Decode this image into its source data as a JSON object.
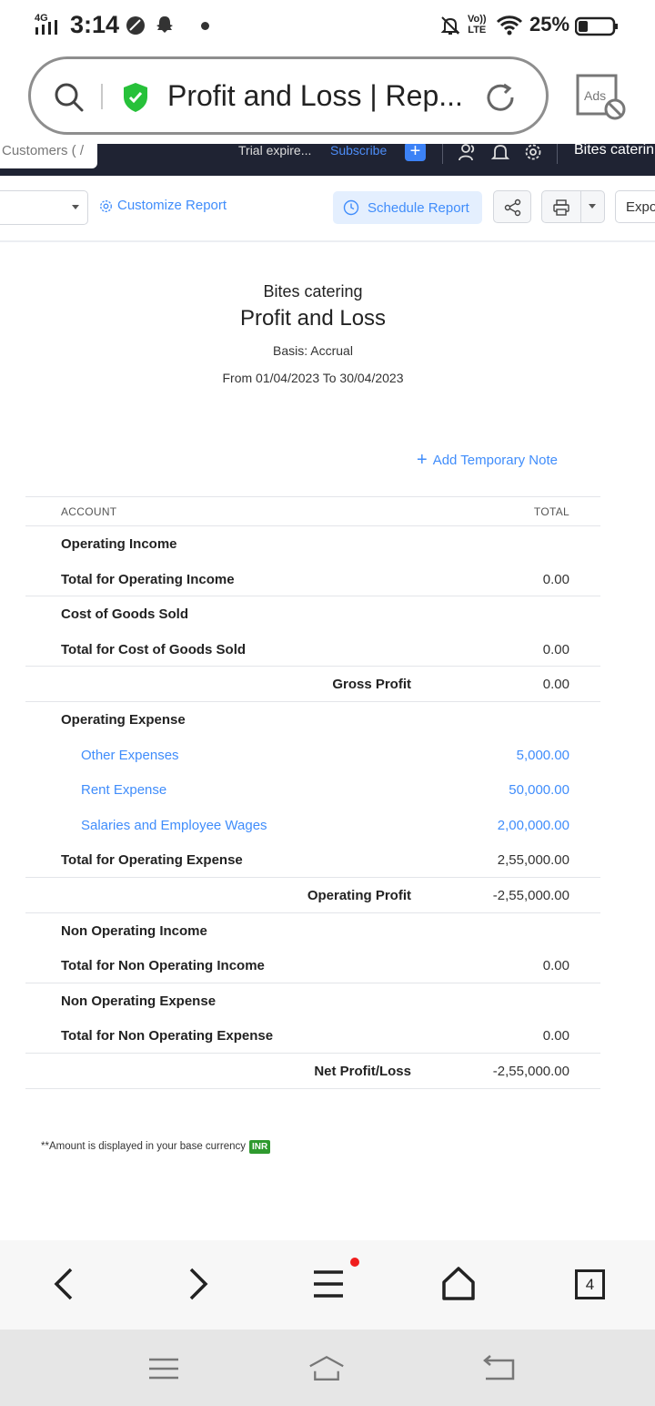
{
  "status_bar": {
    "network": "4G",
    "time": "3:14",
    "volte": "Vo))\nLTE",
    "battery_pct": "25%"
  },
  "browser": {
    "url_title": "Profit and Loss | Rep...",
    "ads_label": "Ads",
    "tab_count": "4"
  },
  "app_header": {
    "tab_label": "Customers ( /",
    "trial": "Trial expire...",
    "subscribe": "Subscribe",
    "plus": "+",
    "org_name": "Bites caterin"
  },
  "toolbar": {
    "customize": "Customize Report",
    "schedule": "Schedule Report",
    "export": "Expo"
  },
  "report": {
    "company": "Bites catering",
    "title": "Profit and Loss",
    "basis": "Basis: Accrual",
    "range": "From 01/04/2023 To 30/04/2023",
    "add_note": "Add Temporary Note",
    "columns": {
      "account": "ACCOUNT",
      "total": "TOTAL"
    },
    "rows": [
      {
        "label": "Operating Income",
        "amount": "",
        "kind": "section",
        "sep": false
      },
      {
        "label": "Total for Operating Income",
        "amount": "0.00",
        "kind": "total",
        "sep": true
      },
      {
        "label": "Cost of Goods Sold",
        "amount": "",
        "kind": "section",
        "sep": false
      },
      {
        "label": "Total for Cost of Goods Sold",
        "amount": "0.00",
        "kind": "total",
        "sep": true
      },
      {
        "label": "Gross Profit",
        "amount": "0.00",
        "kind": "summary",
        "sep": true
      },
      {
        "label": "Operating Expense",
        "amount": "",
        "kind": "section",
        "sep": false
      },
      {
        "label": "Other Expenses",
        "amount": "5,000.00",
        "kind": "account",
        "sep": false
      },
      {
        "label": "Rent Expense",
        "amount": "50,000.00",
        "kind": "account",
        "sep": false
      },
      {
        "label": "Salaries and Employee Wages",
        "amount": "2,00,000.00",
        "kind": "account",
        "sep": false
      },
      {
        "label": "Total for Operating Expense",
        "amount": "2,55,000.00",
        "kind": "total",
        "sep": true
      },
      {
        "label": "Operating Profit",
        "amount": "-2,55,000.00",
        "kind": "summary",
        "sep": true
      },
      {
        "label": "Non Operating Income",
        "amount": "",
        "kind": "section",
        "sep": false
      },
      {
        "label": "Total for Non Operating Income",
        "amount": "0.00",
        "kind": "total",
        "sep": true
      },
      {
        "label": "Non Operating Expense",
        "amount": "",
        "kind": "section",
        "sep": false
      },
      {
        "label": "Total for Non Operating Expense",
        "amount": "0.00",
        "kind": "total",
        "sep": true
      },
      {
        "label": "Net Profit/Loss",
        "amount": "-2,55,000.00",
        "kind": "summary",
        "sep": true
      }
    ],
    "footnote": "**Amount is displayed in your base currency",
    "currency": "INR"
  },
  "colors": {
    "accent": "#408dfb",
    "header_bg": "#1f2333",
    "currency_badge": "#2f9a2f",
    "shield": "#27c13a",
    "notification_dot": "#f01d1d"
  },
  "icons": [
    "search-icon",
    "shield-check-icon",
    "reload-icon",
    "ads-block-icon",
    "gear-icon",
    "clock-icon",
    "share-icon",
    "printer-icon",
    "bell-icon",
    "users-icon",
    "back-icon",
    "forward-icon",
    "menu-icon",
    "home-icon"
  ]
}
